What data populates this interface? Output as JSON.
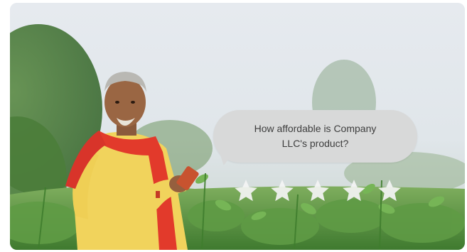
{
  "prompt": {
    "question": "How affordable is Company LLC's product?"
  },
  "rating": {
    "max_stars": 5,
    "selected": 0,
    "star_color": "#f4f4f4"
  },
  "photo": {
    "subject": "farmer-with-phone",
    "scarf_color": "#e23a2b",
    "shirt_color": "#f2d55a",
    "field_color": "#5f9b45",
    "sky_color": "#e3e8ed"
  }
}
